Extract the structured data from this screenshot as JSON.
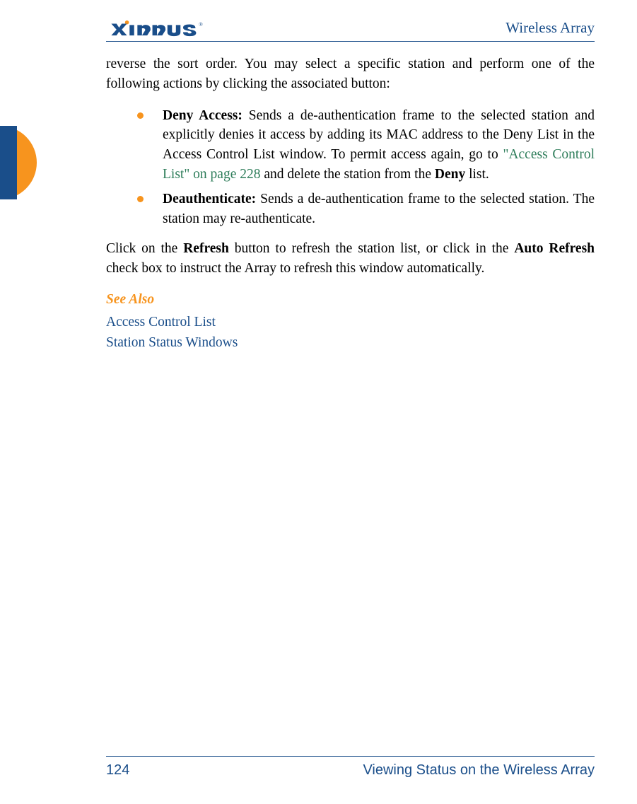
{
  "header": {
    "logo_text": "XIRRUS",
    "title": "Wireless Array"
  },
  "content": {
    "intro": "reverse the sort order. You may select a specific station and perform one of the following actions by clicking the associated button:",
    "bullets": [
      {
        "label": "Deny Access:",
        "text_before_link": " Sends a de-authentication frame to the selected station and explicitly denies it access by adding its MAC address to the Deny List in the Access Control List window. To permit access again, go to ",
        "link_text": "\"Access Control List\" on page 228",
        "text_after_link_1": " and delete the station from the ",
        "bold_word": "Deny",
        "text_after_link_2": " list."
      },
      {
        "label": "Deauthenticate:",
        "text": " Sends a de-authentication frame to the selected station. The station may re-authenticate."
      }
    ],
    "para_before_bold1": "Click on the ",
    "para_bold1": "Refresh",
    "para_mid": " button to refresh the station list, or click in the ",
    "para_bold2": "Auto Refresh",
    "para_after": " check box to instruct the Array to refresh this window automatically.",
    "see_also_heading": "See Also",
    "see_also_links": [
      "Access Control List",
      "Station Status Windows"
    ]
  },
  "footer": {
    "page_number": "124",
    "section_title": "Viewing Status on the Wireless Array"
  }
}
